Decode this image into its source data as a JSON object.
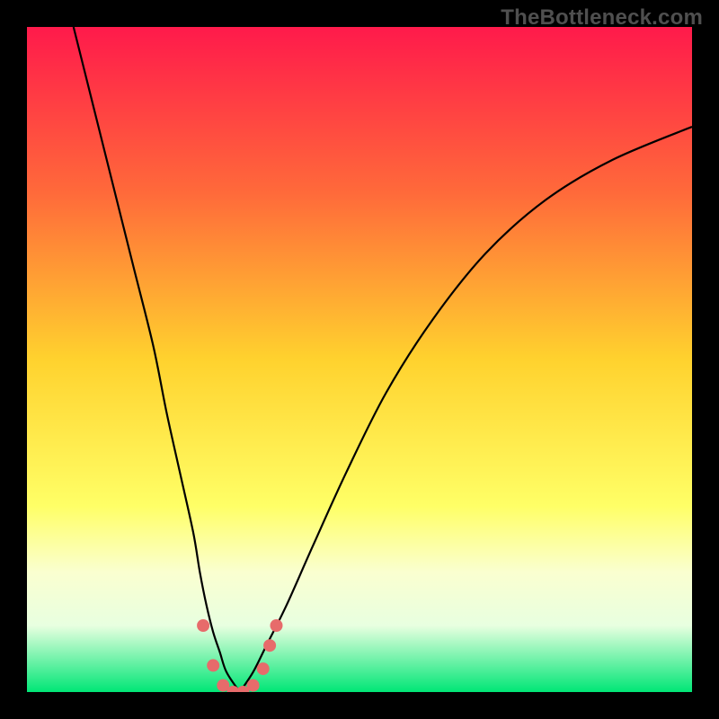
{
  "watermark": "TheBottleneck.com",
  "chart_data": {
    "type": "line",
    "title": "",
    "xlabel": "",
    "ylabel": "",
    "xlim": [
      0,
      100
    ],
    "ylim": [
      0,
      100
    ],
    "grid": false,
    "legend": false,
    "background_gradient": {
      "stops": [
        {
          "offset": 0.0,
          "color": "#ff1a4b"
        },
        {
          "offset": 0.25,
          "color": "#ff6a3a"
        },
        {
          "offset": 0.5,
          "color": "#ffd22e"
        },
        {
          "offset": 0.72,
          "color": "#ffff66"
        },
        {
          "offset": 0.82,
          "color": "#faffd0"
        },
        {
          "offset": 0.9,
          "color": "#e8ffe0"
        },
        {
          "offset": 1.0,
          "color": "#00e676"
        }
      ]
    },
    "series": [
      {
        "name": "curve-left",
        "x": [
          7,
          10,
          13,
          16,
          19,
          21,
          23,
          25,
          26,
          27,
          28,
          29,
          30,
          32
        ],
        "y": [
          100,
          88,
          76,
          64,
          52,
          42,
          33,
          24,
          18,
          13,
          9,
          6,
          3,
          0
        ]
      },
      {
        "name": "curve-right",
        "x": [
          32,
          34,
          36,
          39,
          43,
          48,
          54,
          61,
          69,
          78,
          88,
          100
        ],
        "y": [
          0,
          3,
          7,
          13,
          22,
          33,
          45,
          56,
          66,
          74,
          80,
          85
        ]
      }
    ],
    "points": [
      {
        "x": 26.5,
        "y": 10
      },
      {
        "x": 28.0,
        "y": 4
      },
      {
        "x": 29.5,
        "y": 1
      },
      {
        "x": 31.0,
        "y": 0
      },
      {
        "x": 32.5,
        "y": 0
      },
      {
        "x": 34.0,
        "y": 1
      },
      {
        "x": 35.5,
        "y": 3.5
      },
      {
        "x": 36.5,
        "y": 7
      },
      {
        "x": 37.5,
        "y": 10
      }
    ],
    "point_style": {
      "color": "#e76b6b",
      "radius_px": 7
    }
  }
}
